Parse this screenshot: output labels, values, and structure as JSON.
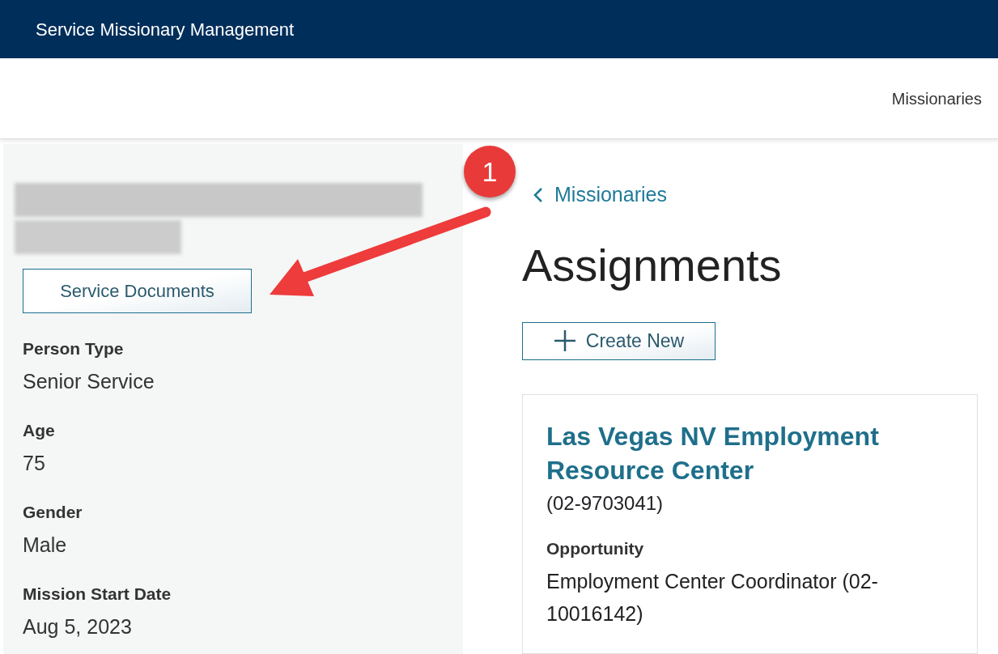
{
  "header": {
    "title": "Service Missionary Management"
  },
  "nav": {
    "links": [
      {
        "label": "Missionaries"
      }
    ]
  },
  "profile": {
    "documents_button": "Service Documents",
    "fields": [
      {
        "label": "Person Type",
        "value": "Senior Service"
      },
      {
        "label": "Age",
        "value": "75"
      },
      {
        "label": "Gender",
        "value": "Male"
      },
      {
        "label": "Mission Start Date",
        "value": "Aug 5, 2023"
      }
    ]
  },
  "callout": {
    "number": "1"
  },
  "breadcrumb": {
    "label": "Missionaries"
  },
  "heading": "Assignments",
  "create_button": "Create New",
  "assignment": {
    "title": "Las Vegas NV Employment Resource Center",
    "code": "(02-9703041)",
    "fields": [
      {
        "label": "Opportunity",
        "value": "Employment Center Coordinator (02-10016142)"
      }
    ]
  }
}
